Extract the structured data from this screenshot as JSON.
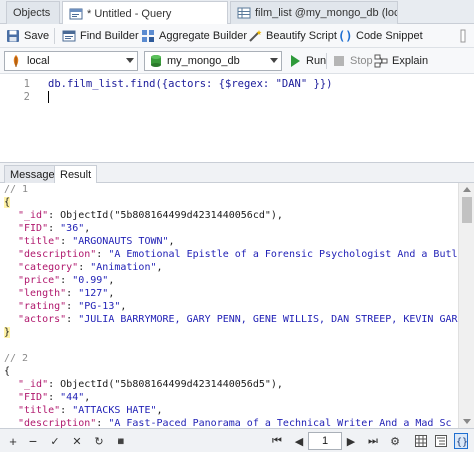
{
  "tabs": [
    {
      "label": "Objects"
    },
    {
      "label": "* Untitled - Query"
    },
    {
      "label": "film_list @my_mongo_db (loc..."
    }
  ],
  "toolbar": {
    "save": "Save",
    "find_builder": "Find Builder",
    "aggregate_builder": "Aggregate Builder",
    "beautify": "Beautify Script",
    "code_snippet": "Code Snippet"
  },
  "connection": {
    "server": "local",
    "database": "my_mongo_db",
    "run": "Run",
    "stop": "Stop",
    "explain": "Explain"
  },
  "editor": {
    "lines": [
      {
        "num": "1",
        "code": "db.film_list.find({actors: {$regex: \"DAN\" }})"
      },
      {
        "num": "2",
        "code": ""
      }
    ]
  },
  "result_tabs": [
    {
      "label": "Message"
    },
    {
      "label": "Result"
    }
  ],
  "results": {
    "doc1_comment": "// 1",
    "doc1": [
      {
        "key": "\"_id\"",
        "sep": ": ",
        "val": "ObjectId(\"5b808164499d4231440056cd\")",
        "tail": ","
      },
      {
        "key": "\"FID\"",
        "sep": ": ",
        "val": "\"36\"",
        "tail": ","
      },
      {
        "key": "\"title\"",
        "sep": ": ",
        "val": "\"ARGONAUTS TOWN\"",
        "tail": ","
      },
      {
        "key": "\"description\"",
        "sep": ": ",
        "val": "\"A Emotional Epistle of a Forensic Psychologist And a Butl",
        "tail": ""
      },
      {
        "key": "\"category\"",
        "sep": ": ",
        "val": "\"Animation\"",
        "tail": ","
      },
      {
        "key": "\"price\"",
        "sep": ": ",
        "val": "\"0.99\"",
        "tail": ","
      },
      {
        "key": "\"length\"",
        "sep": ": ",
        "val": "\"127\"",
        "tail": ","
      },
      {
        "key": "\"rating\"",
        "sep": ": ",
        "val": "\"PG-13\"",
        "tail": ","
      },
      {
        "key": "\"actors\"",
        "sep": ": ",
        "val": "\"JULIA BARRYMORE, GARY PENN, GENE WILLIS, DAN STREEP, KEVIN GAR",
        "tail": ""
      }
    ],
    "doc2_comment": "// 2",
    "doc2": [
      {
        "key": "\"_id\"",
        "sep": ": ",
        "val": "ObjectId(\"5b808164499d4231440056d5\")",
        "tail": ","
      },
      {
        "key": "\"FID\"",
        "sep": ": ",
        "val": "\"44\"",
        "tail": ","
      },
      {
        "key": "\"title\"",
        "sep": ": ",
        "val": "\"ATTACKS HATE\"",
        "tail": ","
      },
      {
        "key": "\"description\"",
        "sep": ": ",
        "val": "\"A Fast-Paced Panorama of a Technical Writer And a Mad Sc",
        "tail": ""
      }
    ],
    "open_brace": "{",
    "close_brace": "}"
  },
  "pager": {
    "page": "1"
  },
  "colors": {
    "accent": "#1f6fd1",
    "run_green": "#2e9a3a",
    "key": "#b0186d",
    "string": "#1f1fb5"
  }
}
